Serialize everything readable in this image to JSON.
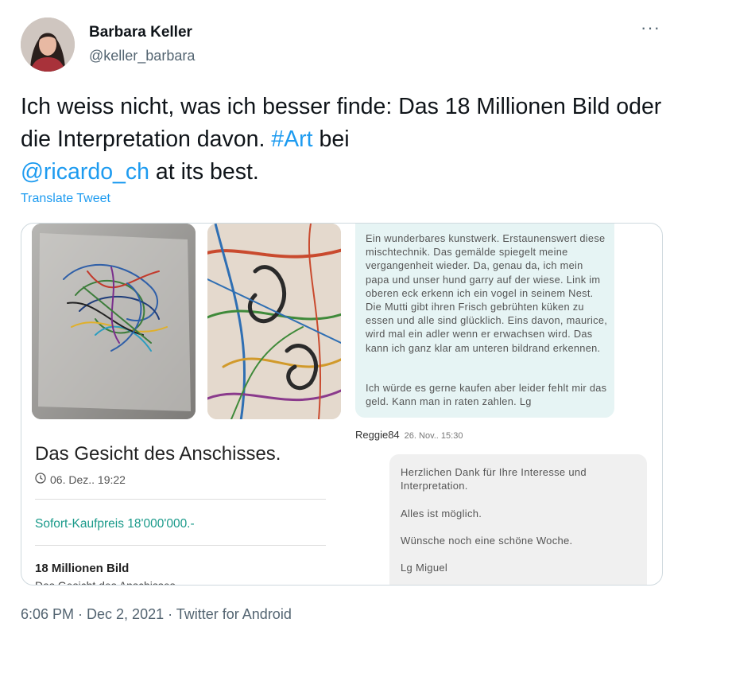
{
  "author": {
    "name": "Barbara Keller",
    "handle": "@keller_barbara"
  },
  "tweet": {
    "text_part1": "Ich weiss nicht, was ich besser finde: Das 18 Millionen Bild oder die Interpretation davon. ",
    "hashtag": "#Art",
    "text_part2": " bei ",
    "mention": "@ricardo_ch",
    "text_part3": " at its best.",
    "translate_label": "Translate Tweet",
    "more_label": "···"
  },
  "listing": {
    "title": "Das Gesicht des Anschisses.",
    "date": "06. Dez.. 19:22",
    "price": "Sofort-Kaufpreis 18'000'000.-",
    "name": "18 Millionen Bild",
    "subline": "Das Gesicht des Anschisses"
  },
  "comment": {
    "text1": "Ein wunderbares kunstwerk. Erstaunenswert diese mischtechnik. Das gemälde spiegelt meine vergangenheit wieder. Da, genau da, ich mein papa und unser hund garry auf der wiese. Link im oberen eck erkenn ich ein vogel in seinem Nest. Die Mutti gibt ihren Frisch gebrühten küken zu essen und alle sind glücklich. Eins davon, maurice, wird mal ein adler wenn er erwachsen wird. Das kann ich ganz klar am unteren bildrand erkennen.",
    "text2": "Ich würde es gerne kaufen aber leider fehlt mir das geld. Kann man in raten zahlen. Lg",
    "user": "Reggie84",
    "time": "26. Nov.. 15:30"
  },
  "reply": {
    "p1": "Herzlichen Dank für Ihre Interesse und Interpretation.",
    "p2": "Alles ist möglich.",
    "p3": "Wünsche noch eine schöne Woche.",
    "p4": "Lg Miguel"
  },
  "footer": {
    "meta": "6:06 PM · Dec 2, 2021 · Twitter for Android"
  }
}
